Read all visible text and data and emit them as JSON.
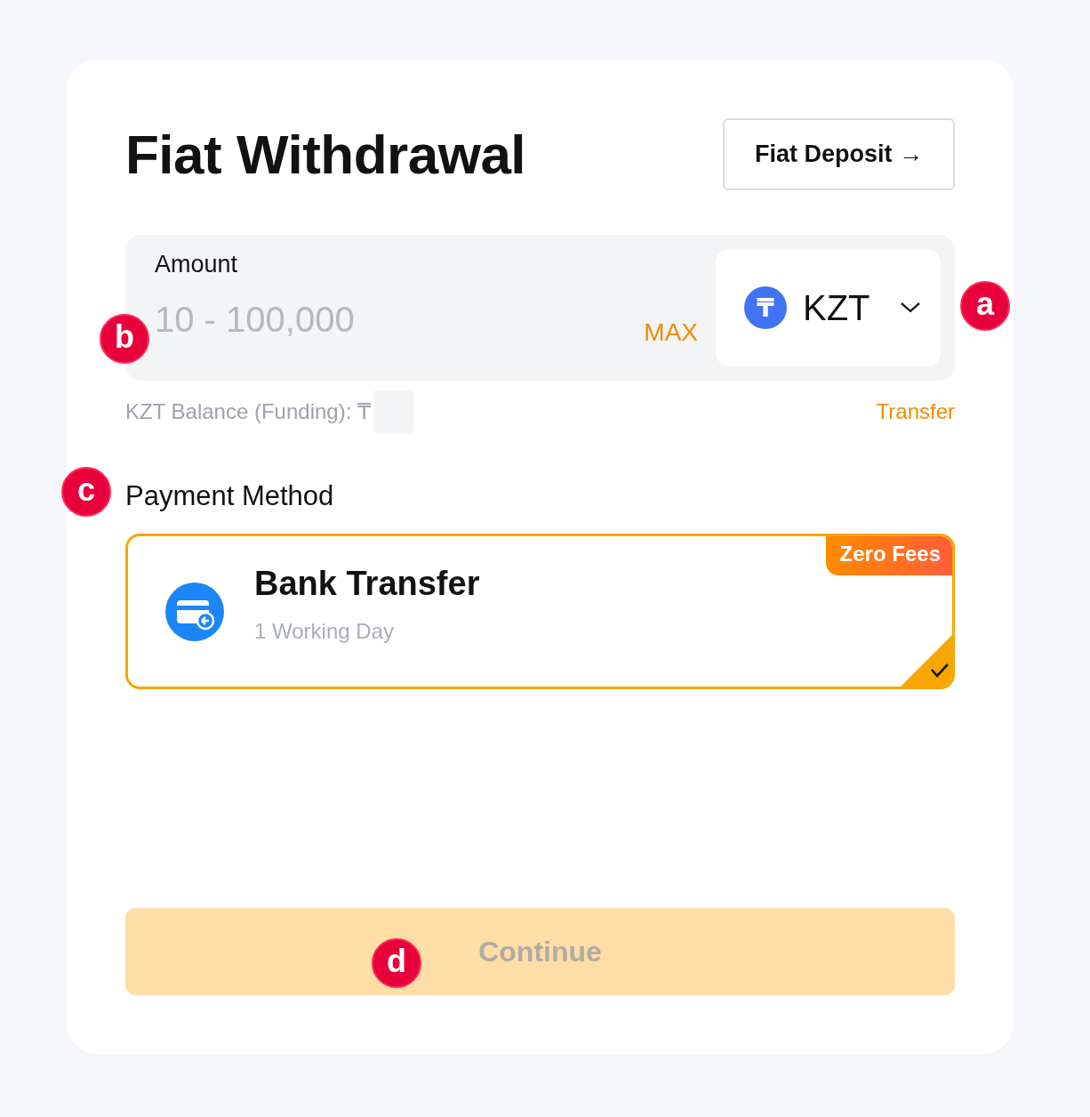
{
  "title": "Fiat Withdrawal",
  "deposit_button": {
    "label": "Fiat Deposit",
    "arrow": "→"
  },
  "amount": {
    "label": "Amount",
    "placeholder": "10 - 100,000",
    "callout": "b",
    "max_label": "MAX",
    "currency": {
      "code": "KZT",
      "symbol": "₸",
      "callout": "a"
    }
  },
  "balance": {
    "label": "KZT Balance (Funding): ₸",
    "value_hidden": true,
    "transfer_link": "Transfer"
  },
  "payment_method": {
    "label": "Payment Method",
    "callout": "c",
    "options": [
      {
        "name": "Bank Transfer",
        "detail": "1 Working Day",
        "badge": "Zero Fees",
        "selected": true
      }
    ]
  },
  "continue_button": {
    "label": "Continue",
    "disabled": true,
    "callout": "d"
  }
}
